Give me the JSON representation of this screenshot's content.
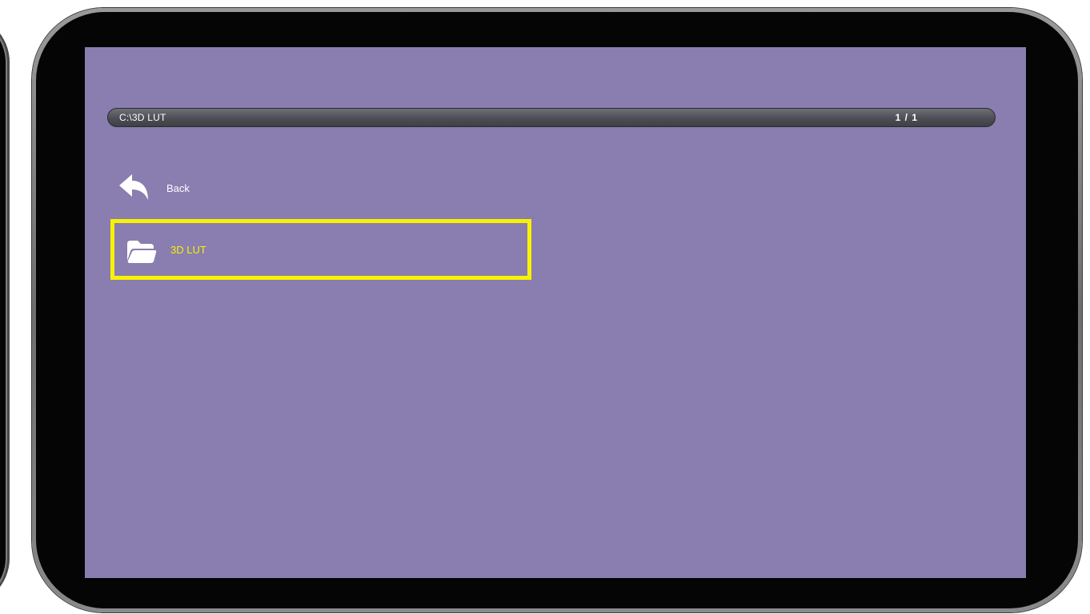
{
  "file_browser": {
    "path": "C:\\3D LUT",
    "page_indicator": "1 / 1",
    "items": [
      {
        "label": "Back",
        "icon": "back-arrow-icon",
        "selected": false
      },
      {
        "label": "3D LUT",
        "icon": "folder-icon",
        "selected": true
      }
    ]
  },
  "colors": {
    "screen_background": "#8a7db0",
    "selection_highlight": "#f7f300",
    "text": "#ffffff"
  }
}
